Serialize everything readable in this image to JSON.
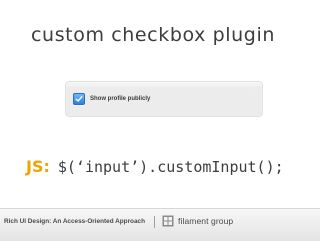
{
  "slide": {
    "title": "custom checkbox plugin",
    "demo": {
      "checkbox_label": "Show profile publicly",
      "checked": true
    },
    "code": {
      "prefix": "JS:",
      "text": "$(‘input’).customInput();"
    },
    "footer": {
      "course_title": "Rich UI Design: An Access-Oriented Approach",
      "brand_name": "filament group"
    }
  },
  "colors": {
    "accent_orange": "#f2a300",
    "checkbox_blue": "#2e7fd6",
    "panel_gray": "#ececec",
    "text_dark": "#3d3d3d"
  },
  "icons": {
    "checkbox": "checkmark-icon",
    "logo": "filament-group-logo-icon"
  }
}
